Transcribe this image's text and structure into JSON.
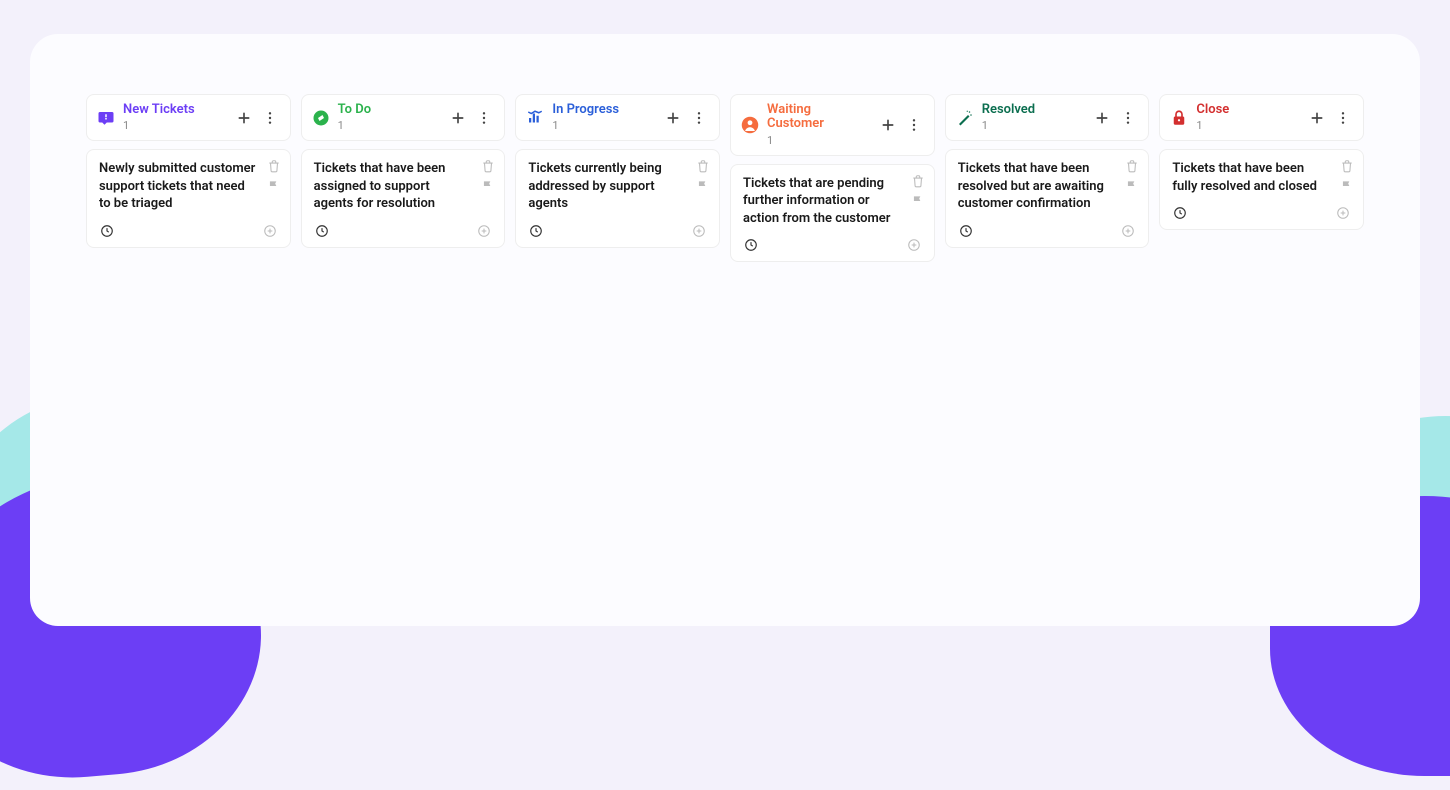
{
  "columns": [
    {
      "id": "new-tickets",
      "title": "New Tickets",
      "count": "1",
      "color": "#6c3ef5",
      "icon": "inbox",
      "card_desc": "Newly submitted customer support tickets that need to be triaged"
    },
    {
      "id": "to-do",
      "title": "To Do",
      "count": "1",
      "color": "#2bb24c",
      "icon": "compass",
      "card_desc": "Tickets that have been assigned to support agents for resolution"
    },
    {
      "id": "in-progress",
      "title": "In Progress",
      "count": "1",
      "color": "#2b5fd9",
      "icon": "chart",
      "card_desc": "Tickets currently being addressed by support agents"
    },
    {
      "id": "waiting-customer",
      "title": "Waiting Customer",
      "count": "1",
      "color": "#f56c3e",
      "icon": "person",
      "card_desc": "Tickets that are pending further information or action from the customer"
    },
    {
      "id": "resolved",
      "title": "Resolved",
      "count": "1",
      "color": "#0b6e4f",
      "icon": "wand",
      "card_desc": "Tickets that have been resolved but are awaiting customer confirmation"
    },
    {
      "id": "close",
      "title": "Close",
      "count": "1",
      "color": "#d32f2f",
      "icon": "lock",
      "card_desc": "Tickets that have been fully resolved and closed"
    }
  ]
}
